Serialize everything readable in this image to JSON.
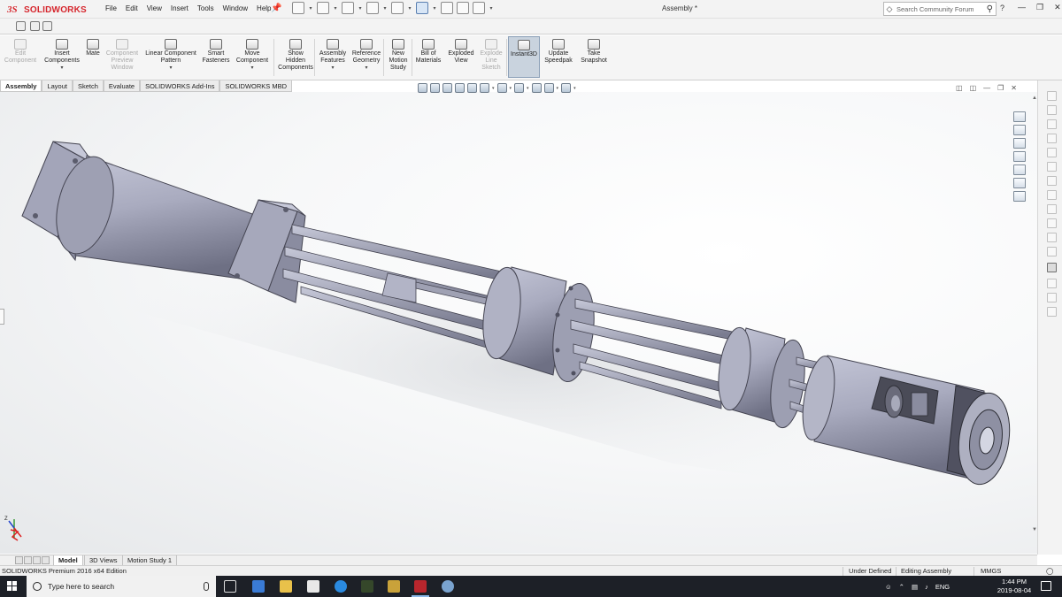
{
  "app": {
    "brand": "SOLIDWORKS",
    "menus": [
      "File",
      "Edit",
      "View",
      "Insert",
      "Tools",
      "Window",
      "Help"
    ],
    "doc_title": "Assembly *",
    "search_placeholder": "Search Community Forum",
    "help_label": "?"
  },
  "commands": [
    {
      "label": "Edit\nComponent",
      "enabled": false,
      "icon": "edit-component-icon"
    },
    {
      "label": "Insert\nComponents",
      "enabled": true,
      "icon": "insert-components-icon",
      "dropdown": true
    },
    {
      "label": "Mate",
      "enabled": true,
      "icon": "mate-icon"
    },
    {
      "label": "Component\nPreview\nWindow",
      "enabled": false,
      "icon": "component-preview-icon"
    },
    {
      "label": "Linear Component\nPattern",
      "enabled": true,
      "icon": "linear-pattern-icon",
      "dropdown": true
    },
    {
      "label": "Smart\nFasteners",
      "enabled": true,
      "icon": "smart-fasteners-icon"
    },
    {
      "label": "Move\nComponent",
      "enabled": true,
      "icon": "move-component-icon",
      "dropdown": true
    },
    {
      "label": "Show\nHidden\nComponents",
      "enabled": true,
      "icon": "show-hidden-icon"
    },
    {
      "label": "Assembly\nFeatures",
      "enabled": true,
      "icon": "assembly-features-icon",
      "dropdown": true
    },
    {
      "label": "Reference\nGeometry",
      "enabled": true,
      "icon": "reference-geometry-icon",
      "dropdown": true
    },
    {
      "label": "New\nMotion\nStudy",
      "enabled": true,
      "icon": "motion-study-icon"
    },
    {
      "label": "Bill of\nMaterials",
      "enabled": true,
      "icon": "bom-icon"
    },
    {
      "label": "Exploded\nView",
      "enabled": true,
      "icon": "exploded-view-icon"
    },
    {
      "label": "Explode\nLine\nSketch",
      "enabled": false,
      "icon": "explode-line-icon"
    },
    {
      "label": "Instant3D",
      "enabled": true,
      "icon": "instant3d-icon",
      "active": true
    },
    {
      "label": "Update\nSpeedpak",
      "enabled": true,
      "icon": "speedpak-icon"
    },
    {
      "label": "Take\nSnapshot",
      "enabled": true,
      "icon": "snapshot-icon"
    }
  ],
  "tabs": [
    "Assembly",
    "Layout",
    "Sketch",
    "Evaluate",
    "SOLIDWORKS Add-Ins",
    "SOLIDWORKS MBD"
  ],
  "active_tab": "Assembly",
  "model_tabs": [
    "Model",
    "3D Views",
    "Motion Study 1"
  ],
  "active_model_tab": "Model",
  "status": {
    "edition": "SOLIDWORKS Premium 2016 x64 Edition",
    "definition": "Under Defined",
    "mode": "Editing Assembly",
    "units": "MMGS"
  },
  "taskbar": {
    "search_placeholder": "Type here to search",
    "language": "ENG",
    "time": "1:44 PM",
    "date": "2019-08-04"
  },
  "triad": {
    "z_label": "Z"
  },
  "colors": {
    "brand_red": "#d6262d",
    "part_gray": "#a9abbf",
    "taskbar": "#1d2027"
  }
}
